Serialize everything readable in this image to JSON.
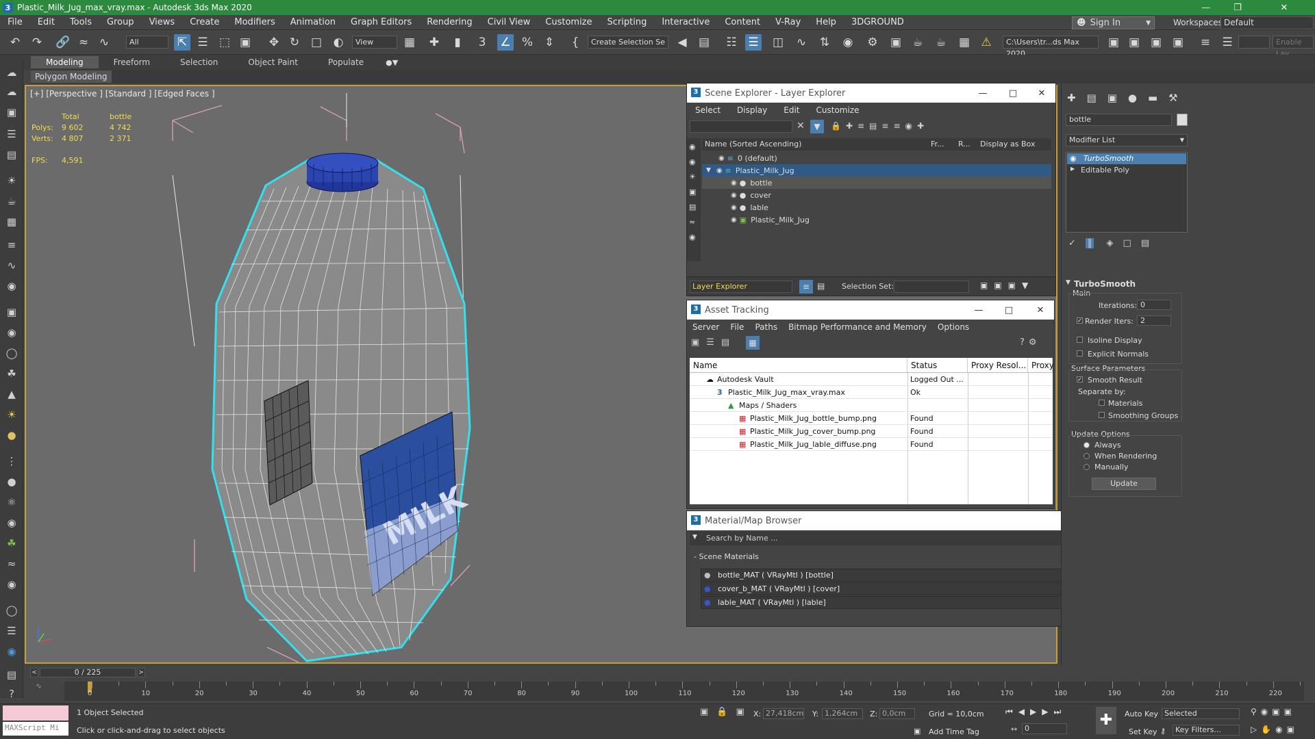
{
  "window": {
    "title": "Plastic_Milk_Jug_max_vray.max - Autodesk 3ds Max 2020",
    "app_icon": "3"
  },
  "menu": [
    "File",
    "Edit",
    "Tools",
    "Group",
    "Views",
    "Create",
    "Modifiers",
    "Animation",
    "Graph Editors",
    "Rendering",
    "Civil View",
    "Customize",
    "Scripting",
    "Interactive",
    "Content",
    "V-Ray",
    "Help",
    "3DGROUND"
  ],
  "account": {
    "sign_in": "Sign In",
    "workspaces_label": "Workspaces:",
    "workspace": "Default"
  },
  "toolbar": {
    "filter": "All",
    "ref_coord": "View",
    "selection_set": "Create Selection Se",
    "path": "C:\\Users\\tr...ds Max 2020",
    "enable": "Enable Lay"
  },
  "ribbon": {
    "tabs": [
      "Modeling",
      "Freeform",
      "Selection",
      "Object Paint",
      "Populate"
    ],
    "panel": "Polygon Modeling"
  },
  "viewport": {
    "label": "[+] [Perspective ] [Standard ] [Edged Faces ]",
    "stats": {
      "col_total": "Total",
      "col_sel": "bottle",
      "polys_label": "Polys:",
      "polys_total": "9 602",
      "polys_sel": "4 742",
      "verts_label": "Verts:",
      "verts_total": "4 807",
      "verts_sel": "2 371",
      "fps_label": "FPS:",
      "fps": "4,591"
    },
    "label_text": "MILK"
  },
  "scene_explorer": {
    "title": "Scene Explorer - Layer Explorer",
    "menu": [
      "Select",
      "Display",
      "Edit",
      "Customize"
    ],
    "cols": {
      "name": "Name (Sorted Ascending)",
      "fr": "Fr...",
      "r": "R...",
      "box": "Display as Box"
    },
    "rows": [
      "0 (default)",
      "Plastic_Milk_Jug",
      "bottle",
      "cover",
      "lable",
      "Plastic_Milk_Jug"
    ],
    "footer": {
      "explorer": "Layer Explorer",
      "selection_set": "Selection Set:"
    }
  },
  "asset_tracking": {
    "title": "Asset Tracking",
    "menu": [
      "Server",
      "File",
      "Paths",
      "Bitmap Performance and Memory",
      "Options"
    ],
    "cols": {
      "name": "Name",
      "status": "Status",
      "proxy_res": "Proxy Resol...",
      "proxy": "Proxy"
    },
    "rows": [
      {
        "name": "Autodesk Vault",
        "status": "Logged Out ..."
      },
      {
        "name": "Plastic_Milk_Jug_max_vray.max",
        "status": "Ok"
      },
      {
        "name": "Maps / Shaders",
        "status": ""
      },
      {
        "name": "Plastic_Milk_Jug_bottle_bump.png",
        "status": "Found"
      },
      {
        "name": "Plastic_Milk_Jug_cover_bump.png",
        "status": "Found"
      },
      {
        "name": "Plastic_Milk_Jug_lable_diffuse.png",
        "status": "Found"
      }
    ]
  },
  "material_browser": {
    "title": "Material/Map Browser",
    "search": "Search by Name ...",
    "group": "- Scene Materials",
    "items": [
      "bottle_MAT  ( VRayMtl )  [bottle]",
      "cover_b_MAT  ( VRayMtl )  [cover]",
      "lable_MAT  ( VRayMtl )  [lable]"
    ]
  },
  "command_panel": {
    "object_name": "bottle",
    "modifier_list": "Modifier List",
    "stack": [
      "TurboSmooth",
      "Editable Poly"
    ],
    "rollout": "TurboSmooth",
    "main": "Main",
    "iterations_label": "Iterations:",
    "iterations": "0",
    "render_iters_label": "Render Iters:",
    "render_iters": "2",
    "isoline": "Isoline Display",
    "explicit_normals": "Explicit Normals",
    "surface_params": "Surface Parameters",
    "smooth_result": "Smooth Result",
    "separate_by": "Separate by:",
    "materials": "Materials",
    "smoothing_groups": "Smoothing Groups",
    "update_options": "Update Options",
    "always": "Always",
    "when_rendering": "When Rendering",
    "manually": "Manually",
    "update_btn": "Update"
  },
  "timeline": {
    "frame": "0 / 225",
    "ticks": [
      "0",
      "10",
      "20",
      "30",
      "40",
      "50",
      "60",
      "70",
      "80",
      "90",
      "100",
      "110",
      "120",
      "130",
      "140",
      "150",
      "160",
      "170",
      "180",
      "190",
      "200",
      "210",
      "220"
    ]
  },
  "status": {
    "maxscript": "MAXScript Mi",
    "selected": "1 Object Selected",
    "hint": "Click or click-and-drag to select objects",
    "x_label": "X:",
    "x": "27,418cm",
    "y_label": "Y:",
    "y": "1,264cm",
    "z_label": "Z:",
    "z": "0,0cm",
    "grid": "Grid = 10,0cm",
    "add_time_tag": "Add Time Tag",
    "auto_key": "Auto Key",
    "selected_mode": "Selected",
    "set_key": "Set Key",
    "key_filters": "Key Filters...",
    "frame": "0"
  }
}
